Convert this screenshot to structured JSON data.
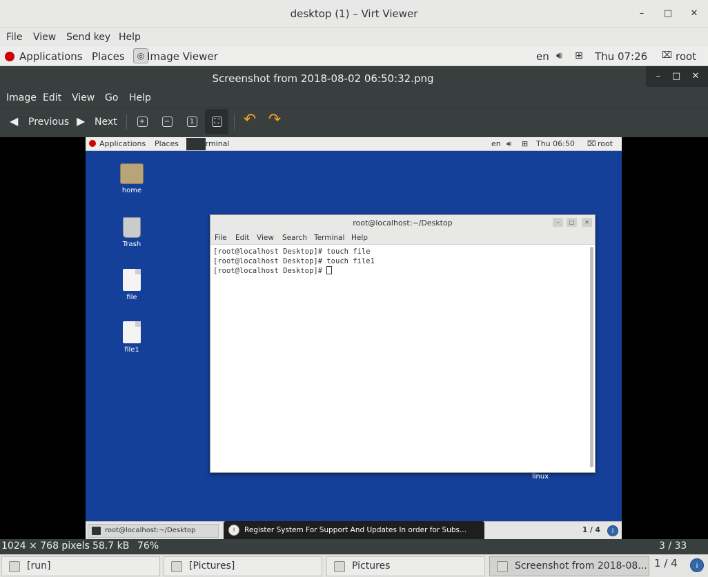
{
  "window": {
    "title": "desktop (1) – Virt Viewer",
    "minimize": "–",
    "maximize": "□",
    "close": "✕"
  },
  "viewer_menu": [
    "File",
    "View",
    "Send key",
    "Help"
  ],
  "guest_topbar": {
    "applications": "Applications",
    "places": "Places",
    "active_app": "Image Viewer",
    "lang": "en",
    "clock": "Thu 07:26",
    "user": "root"
  },
  "image_viewer": {
    "title": "Screenshot from 2018-08-02 06:50:32.png",
    "menu": [
      "Image",
      "Edit",
      "View",
      "Go",
      "Help"
    ],
    "toolbar": {
      "previous": "Previous",
      "next": "Next"
    },
    "status": {
      "dimensions": "1024 × 768 pixels",
      "size": "58.7 kB",
      "zoom": "76%",
      "position": "3 / 33"
    }
  },
  "screenshot": {
    "topbar": {
      "applications": "Applications",
      "places": "Places",
      "active_app": "Terminal",
      "lang": "en",
      "clock": "Thu 06:50",
      "user": "root"
    },
    "desktop_icons": [
      "home",
      "Trash",
      "file",
      "file1"
    ],
    "terminal": {
      "title": "root@localhost:~/Desktop",
      "menu": [
        "File",
        "Edit",
        "View",
        "Search",
        "Terminal",
        "Help"
      ],
      "lines": [
        "[root@localhost Desktop]# touch file",
        "[root@localhost Desktop]# touch file1",
        "[root@localhost Desktop]# "
      ]
    },
    "desktop_label": "linux",
    "taskbar": {
      "item": "root@localhost:~/Desktop",
      "notification": "Register System For Support And Updates  In order for Subs...",
      "pager": "1 / 4"
    }
  },
  "host_taskbar": {
    "items": [
      "[run]",
      "[Pictures]",
      "Pictures",
      "Screenshot from 2018-08..."
    ],
    "pager": "1 / 4"
  }
}
